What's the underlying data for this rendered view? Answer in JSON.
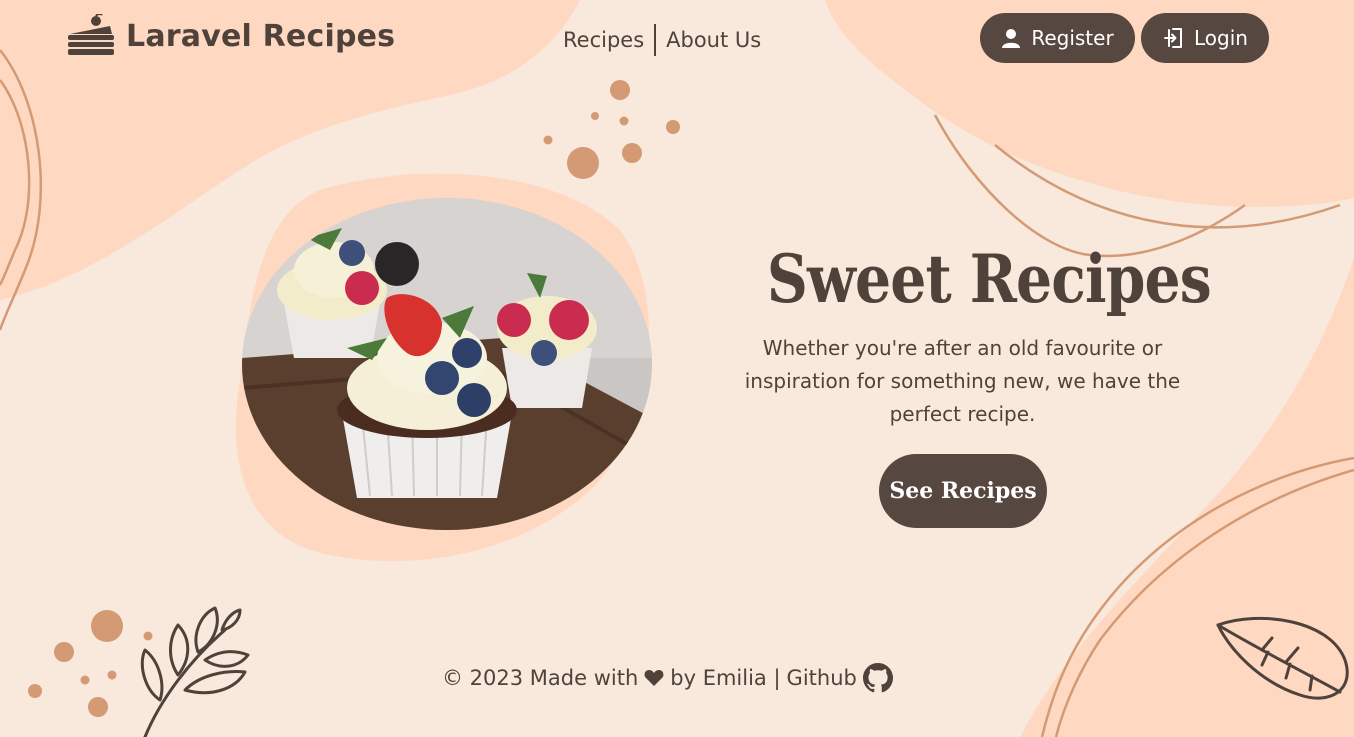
{
  "brand": {
    "title": "Laravel Recipes",
    "logo_icon": "cake-slice-icon"
  },
  "nav": {
    "items": [
      {
        "label": "Recipes"
      },
      {
        "label": "About Us"
      }
    ]
  },
  "auth": {
    "register_label": "Register",
    "login_label": "Login",
    "register_icon": "user-icon",
    "login_icon": "login-icon"
  },
  "hero": {
    "title": "Sweet Recipes",
    "description": "Whether you're after an old favourite or inspiration for something new, we have the perfect recipe.",
    "cta_label": "See Recipes",
    "image_alt": "cupcakes-with-berries"
  },
  "footer": {
    "copyright": "© 2023 Made with",
    "heart_icon": "heart-icon",
    "by_text": "by Emilia |",
    "github_label": "Github",
    "github_icon": "github-icon"
  },
  "colors": {
    "background": "#f8e9dc",
    "blob": "#ffd8c2",
    "accent": "#d39a74",
    "dark": "#564740",
    "text": "#4e423a"
  }
}
